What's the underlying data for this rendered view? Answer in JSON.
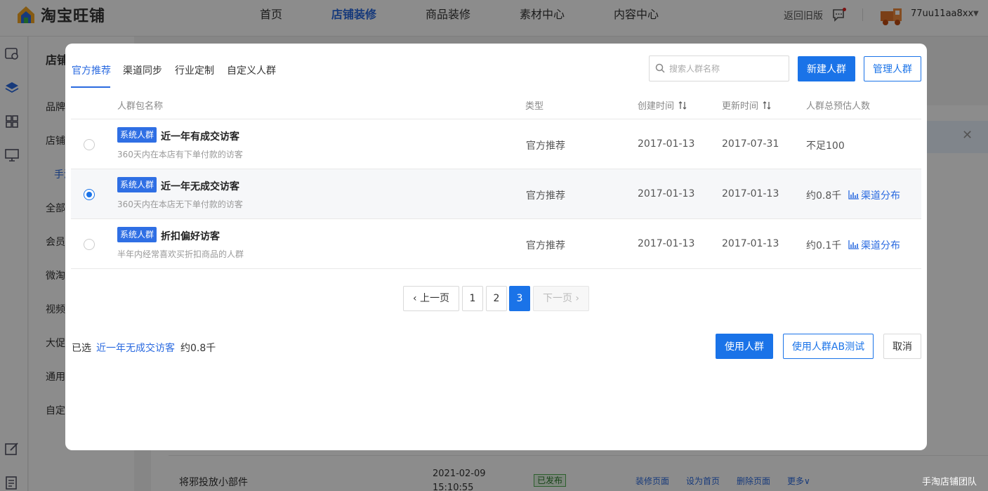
{
  "header": {
    "logo_text": "淘宝旺铺",
    "nav": [
      "首页",
      "店铺装修",
      "商品装修",
      "素材中心",
      "内容中心"
    ],
    "active_nav": "店铺装修",
    "back_old": "返回旧版",
    "username": "77uu11aa8xx"
  },
  "sidemenu": {
    "title": "店铺",
    "items": [
      "品牌",
      "店铺",
      "手淘",
      "全部",
      "会员",
      "微淘",
      "视频",
      "大促",
      "通用",
      "自定"
    ]
  },
  "background_table": {
    "row_name": "将邪投放小部件",
    "row_date": "2021-02-09",
    "row_time": "15:10:55",
    "row_status": "已发布",
    "actions": [
      "装修页面",
      "设为首页",
      "删除页面",
      "更多"
    ],
    "watermark": "手淘店铺团队"
  },
  "modal": {
    "tabs": [
      "官方推荐",
      "渠道同步",
      "行业定制",
      "自定义人群"
    ],
    "active_tab": 0,
    "search_placeholder": "搜索人群名称",
    "new_button": "新建人群",
    "manage_button": "管理人群",
    "columns": {
      "name": "人群包名称",
      "type": "类型",
      "created": "创建时间",
      "updated": "更新时间",
      "estimate": "人群总预估人数"
    },
    "rows": [
      {
        "tag": "系统人群",
        "name": "近一年有成交访客",
        "desc": "360天内在本店有下单付款的访客",
        "type": "官方推荐",
        "created": "2017-01-13",
        "updated": "2017-07-31",
        "count": "不足100",
        "distribution": "",
        "selected": false
      },
      {
        "tag": "系统人群",
        "name": "近一年无成交访客",
        "desc": "360天内在本店无下单付款的访客",
        "type": "官方推荐",
        "created": "2017-01-13",
        "updated": "2017-01-13",
        "count": "约0.8千",
        "distribution": "渠道分布",
        "selected": true
      },
      {
        "tag": "系统人群",
        "name": "折扣偏好访客",
        "desc": "半年内经常喜欢买折扣商品的人群",
        "type": "官方推荐",
        "created": "2017-01-13",
        "updated": "2017-01-13",
        "count": "约0.1千",
        "distribution": "渠道分布",
        "selected": false
      }
    ],
    "pagination": {
      "prev": "上一页",
      "pages": [
        "1",
        "2",
        "3"
      ],
      "current": "3",
      "next": "下一页"
    },
    "footer": {
      "selected_label": "已选",
      "selected_name": "近一年无成交访客",
      "selected_count": "约0.8千",
      "use_button": "使用人群",
      "ab_button": "使用人群AB测试",
      "cancel_button": "取消"
    }
  },
  "colors": {
    "primary": "#1a73e8",
    "link": "#2a6ae0",
    "tag": "#2f6fe4"
  }
}
